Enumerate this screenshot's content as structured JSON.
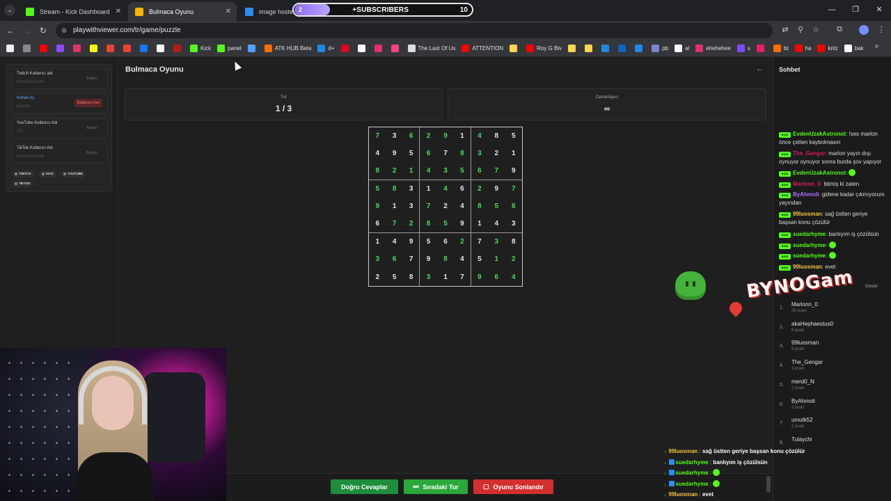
{
  "browser": {
    "tabs": [
      {
        "title": "Stream - Kick Dashboard",
        "favicon_color": "#53fc18",
        "active": false
      },
      {
        "title": "Bulmaca Oyunu",
        "favicon_color": "#f4b400",
        "active": true
      },
      {
        "title": "image hosted a",
        "favicon_color": "#2d8cf0",
        "active": false
      }
    ],
    "url": "playwithviewer.com/tr/game/puzzle",
    "bookmarks": [
      {
        "label": "",
        "color": "#eeeeee"
      },
      {
        "label": "",
        "color": "#888888"
      },
      {
        "label": "",
        "color": "#ff0000"
      },
      {
        "label": "",
        "color": "#9146ff"
      },
      {
        "label": "",
        "color": "#e1306c"
      },
      {
        "label": "",
        "color": "#fffc00"
      },
      {
        "label": "",
        "color": "#ea4335"
      },
      {
        "label": "",
        "color": "#ea4335"
      },
      {
        "label": "",
        "color": "#1877f2"
      },
      {
        "label": "",
        "color": "#ffffff"
      },
      {
        "label": "",
        "color": "#b71c1c"
      },
      {
        "label": "Kick",
        "color": "#53fc18"
      },
      {
        "label": "panel",
        "color": "#53fc18"
      },
      {
        "label": "",
        "color": "#4da3ff"
      },
      {
        "label": "ATK HUB Beta",
        "color": "#ff6d00"
      },
      {
        "label": "d+",
        "color": "#1e88e5"
      },
      {
        "label": "",
        "color": "#e60023"
      },
      {
        "label": "",
        "color": "#ffffff"
      },
      {
        "label": "",
        "color": "#e1306c"
      },
      {
        "label": "",
        "color": "#ff4081"
      },
      {
        "label": "The Last Of Us",
        "color": "#dddddd"
      },
      {
        "label": "ATTENTION",
        "color": "#ff0000"
      },
      {
        "label": "",
        "color": "#ffd54f"
      },
      {
        "label": "Roy G Biv",
        "color": "#ff0000"
      },
      {
        "label": "",
        "color": "#ffd54f"
      },
      {
        "label": "",
        "color": "#ffd54f"
      },
      {
        "label": "",
        "color": "#1e88e5"
      },
      {
        "label": "",
        "color": "#0a66c2"
      },
      {
        "label": "",
        "color": "#1e88e5"
      },
      {
        "label": "pb",
        "color": "#7986cb"
      },
      {
        "label": "al",
        "color": "#ffffff"
      },
      {
        "label": "ehehehee",
        "color": "#e1306c"
      },
      {
        "label": "s",
        "color": "#7c4dff"
      },
      {
        "label": "",
        "color": "#e91e63"
      },
      {
        "label": "bt",
        "color": "#ff6d00"
      },
      {
        "label": "ha",
        "color": "#ff0000"
      },
      {
        "label": "knlz",
        "color": "#ff0000"
      },
      {
        "label": "bak",
        "color": "#ffffff"
      }
    ]
  },
  "stream_overlay": {
    "subs_progress": "2",
    "subs_label": "+SUBSCRIBERS",
    "subs_goal": "10",
    "subs_fill": 0.2,
    "brand": "BYNOGam"
  },
  "left_panel": {
    "accounts": [
      {
        "label": "Twitch Kullanıcı adı",
        "placeholder": "Kanal Kısa Adı",
        "button": "Bağlan",
        "connected": false
      },
      {
        "label": "Kanalı Aç",
        "placeholder": "bulaybi",
        "button": "Bağlantıyı Kes",
        "connected": true
      },
      {
        "label": "YouTube Kullanıcı Adı",
        "placeholder": "UC...",
        "button": "Bağlan",
        "connected": false
      },
      {
        "label": "TikTok Kullanıcı Adı",
        "placeholder": "Kanal Kısa Adı",
        "button": "Bağlan",
        "connected": false
      }
    ],
    "platforms": [
      "TWITCH",
      "KICK",
      "YOUTUBE",
      "TİKTOK"
    ]
  },
  "game": {
    "title": "Bulmaca Oyunu",
    "round_label": "Tur",
    "round_value": "1 / 3",
    "timer_label": "Zamanlayıcı",
    "timer_value": "∞",
    "grid": [
      [
        7,
        3,
        6,
        2,
        9,
        1,
        4,
        8,
        5
      ],
      [
        4,
        9,
        5,
        6,
        7,
        8,
        3,
        2,
        1
      ],
      [
        8,
        2,
        1,
        4,
        3,
        5,
        6,
        7,
        9
      ],
      [
        5,
        8,
        3,
        1,
        4,
        6,
        2,
        9,
        7
      ],
      [
        9,
        1,
        3,
        7,
        2,
        4,
        8,
        5,
        6
      ],
      [
        6,
        7,
        2,
        8,
        5,
        9,
        1,
        4,
        3
      ],
      [
        1,
        4,
        9,
        5,
        6,
        2,
        7,
        3,
        8
      ],
      [
        3,
        6,
        7,
        9,
        8,
        4,
        5,
        1,
        2
      ],
      [
        2,
        5,
        8,
        3,
        1,
        7,
        9,
        6,
        4
      ]
    ],
    "given_mask": [
      [
        1,
        0,
        1,
        1,
        1,
        0,
        1,
        0,
        0
      ],
      [
        0,
        0,
        0,
        1,
        0,
        1,
        1,
        0,
        0
      ],
      [
        1,
        1,
        1,
        1,
        1,
        1,
        1,
        1,
        0
      ],
      [
        1,
        1,
        0,
        0,
        1,
        0,
        1,
        0,
        1
      ],
      [
        1,
        0,
        0,
        1,
        0,
        0,
        1,
        1,
        1
      ],
      [
        0,
        1,
        1,
        1,
        1,
        0,
        0,
        0,
        0
      ],
      [
        0,
        0,
        0,
        0,
        0,
        1,
        0,
        1,
        0
      ],
      [
        1,
        1,
        0,
        0,
        1,
        0,
        0,
        1,
        1
      ],
      [
        0,
        0,
        0,
        1,
        0,
        0,
        1,
        1,
        1
      ]
    ],
    "buttons": {
      "correct": "Doğru Cevaplar",
      "next": "Sıradaki Tur",
      "end": "Oyunu Sonlandır"
    }
  },
  "chat": {
    "title": "Sohbet",
    "messages": [
      {
        "user": "EvdenUzakAstronot",
        "color": "#53fc18",
        "text": "!ses marlon önce çetten kaybolmasın"
      },
      {
        "user": "The_Gengar",
        "color": "#d81b60",
        "text": "marlon yayın dışı oynuyor oynuyor sonra burda şov yapıyor"
      },
      {
        "user": "EvdenUzakAstronot",
        "color": "#53fc18",
        "text": ""
      },
      {
        "user": "Marlonn_0",
        "color": "#d81b60",
        "text": "bitmiş ki zaten"
      },
      {
        "user": "ByAhmoli",
        "color": "#b36bff",
        "text": "gidene kadar çıkmıyorum yayından"
      },
      {
        "user": "99luosman",
        "color": "#f5c542",
        "text": "sağ üstten geriye başsan konu çözülür"
      },
      {
        "user": "suedarhyme",
        "color": "#53fc18",
        "text": "banlıyım iş çözülsün"
      },
      {
        "user": "suedarhyme",
        "color": "#53fc18",
        "text": ""
      },
      {
        "user": "suedarhyme",
        "color": "#53fc18",
        "text": ""
      },
      {
        "user": "99luosman",
        "color": "#f5c542",
        "text": "evet"
      }
    ],
    "leaderboard_title": "Sıralama",
    "leaderboard_toggle": "Göster",
    "leaderboard": [
      {
        "rank": "1.",
        "name": "Marlonn_0",
        "points": "26 puan"
      },
      {
        "rank": "2.",
        "name": "akaHephaestus0",
        "points": "8 puan"
      },
      {
        "rank": "3.",
        "name": "99luosman",
        "points": "6 puan"
      },
      {
        "rank": "4.",
        "name": "The_Gengar",
        "points": "3 puan"
      },
      {
        "rank": "5.",
        "name": "merd0_N",
        "points": "2 puan"
      },
      {
        "rank": "6.",
        "name": "ByAhmoli",
        "points": "2 puan"
      },
      {
        "rank": "7.",
        "name": "umutk52",
        "points": "2 puan"
      },
      {
        "rank": "8.",
        "name": "Tulaychi",
        "points": ""
      }
    ]
  },
  "overlay_chat": [
    {
      "user": "99luosman",
      "color": "#f5c542",
      "text": "sağ üstten geriye başsan konu çözülür",
      "platform": "kick"
    },
    {
      "user": "suedarhyme",
      "color": "#53fc18",
      "text": "banlıyım iş çözülsün",
      "platform": "twitch"
    },
    {
      "user": "suedarhyme",
      "color": "#53fc18",
      "text": "",
      "platform": "twitch"
    },
    {
      "user": "suedarhyme",
      "color": "#53fc18",
      "text": "",
      "platform": "twitch"
    },
    {
      "user": "99luosman",
      "color": "#f5c542",
      "text": "evet",
      "platform": "kick"
    }
  ]
}
